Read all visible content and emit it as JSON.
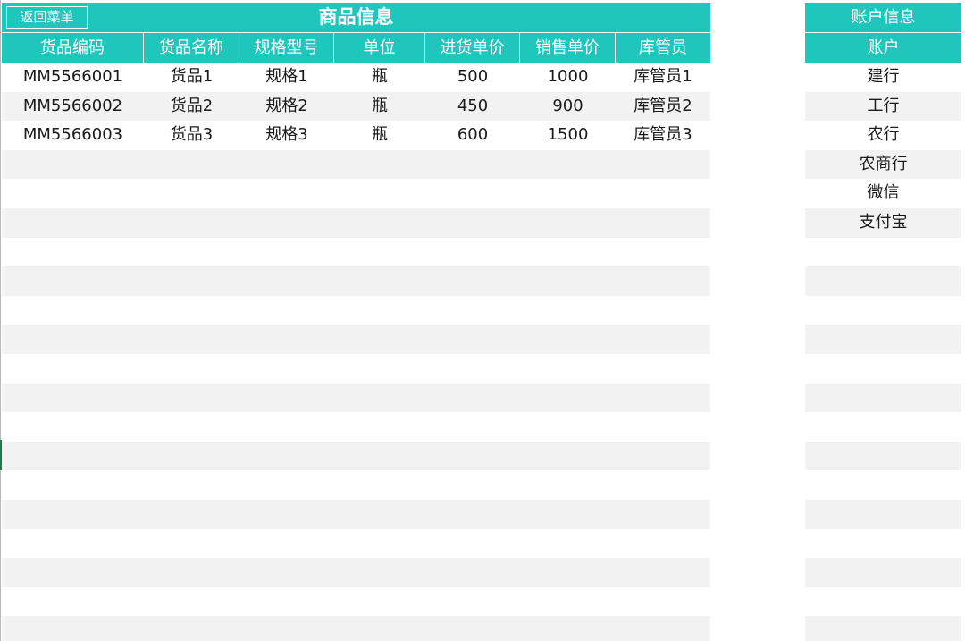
{
  "goods": {
    "back_button": "返回菜单",
    "title": "商品信息",
    "columns": [
      "货品编码",
      "货品名称",
      "规格型号",
      "单位",
      "进货单价",
      "销售单价",
      "库管员"
    ],
    "rows": [
      [
        "MM5566001",
        "货品1",
        "规格1",
        "瓶",
        "500",
        "1000",
        "库管员1"
      ],
      [
        "MM5566002",
        "货品2",
        "规格2",
        "瓶",
        "450",
        "900",
        "库管员2"
      ],
      [
        "MM5566003",
        "货品3",
        "规格3",
        "瓶",
        "600",
        "1500",
        "库管员3"
      ]
    ]
  },
  "accounts": {
    "title": "账户信息",
    "header": "账户",
    "items": [
      "建行",
      "工行",
      "农行",
      "农商行",
      "微信",
      "支付宝"
    ]
  },
  "colors": {
    "header_teal": "#1fc6bc",
    "stripe": "#f2f2f2",
    "header_text": "#ffffff",
    "body_text": "#1a1a1a"
  }
}
